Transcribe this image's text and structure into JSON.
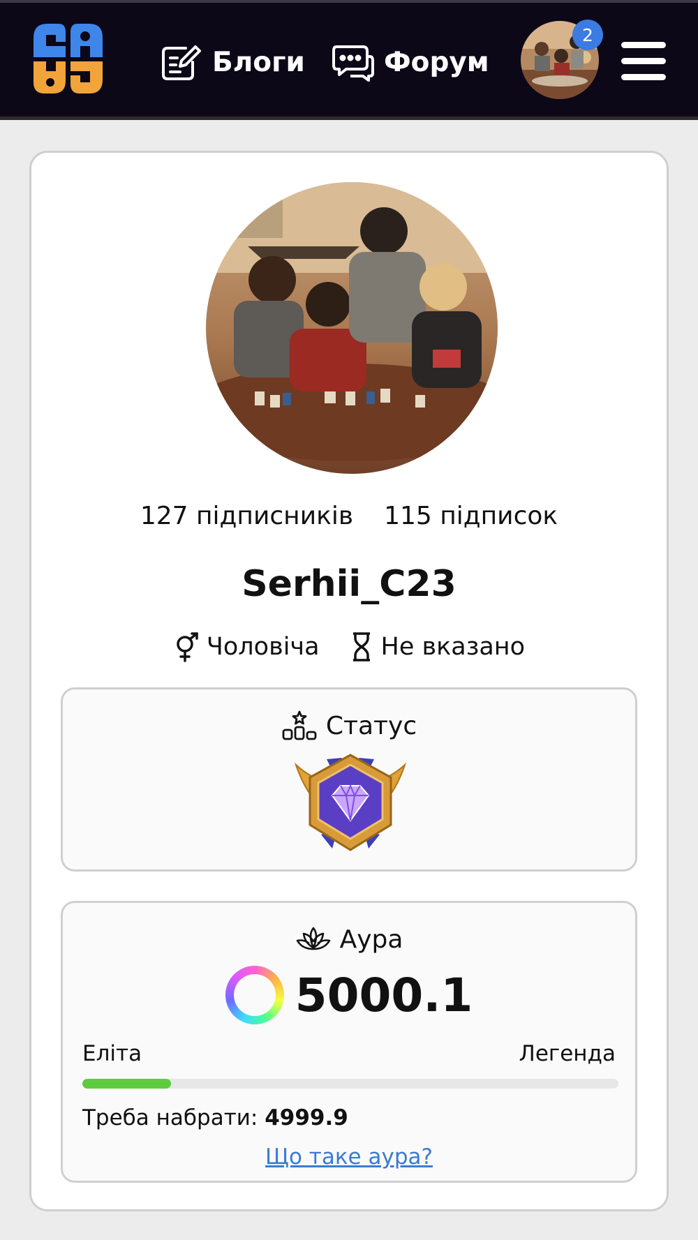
{
  "header": {
    "nav": [
      {
        "label": "Блоги",
        "icon": "edit-note-icon"
      },
      {
        "label": "Форум",
        "icon": "chat-bubbles-icon"
      }
    ],
    "notifications_count": "2",
    "colors": {
      "background": "#0c0818",
      "logo_blue": "#3f86ea",
      "logo_orange": "#f1a43a",
      "badge": "#3b7be2"
    }
  },
  "profile": {
    "followers": "127 підписників",
    "following": "115 підписок",
    "username": "Serhii_C23",
    "gender": "Чоловіча",
    "age": "Не вказано"
  },
  "status": {
    "title": "Статус",
    "icon": "podium-star-icon",
    "badge": "diamond-rank-badge"
  },
  "aura": {
    "title": "Аура",
    "icon": "lotus-icon",
    "value": "5000.1",
    "level_current": "Еліта",
    "level_next": "Легенда",
    "progress_percent": 16.5,
    "need_label": "Треба набрати:",
    "need_value": "4999.9",
    "link_text": "Що таке аура?",
    "progress_color": "#5ecb3f"
  }
}
